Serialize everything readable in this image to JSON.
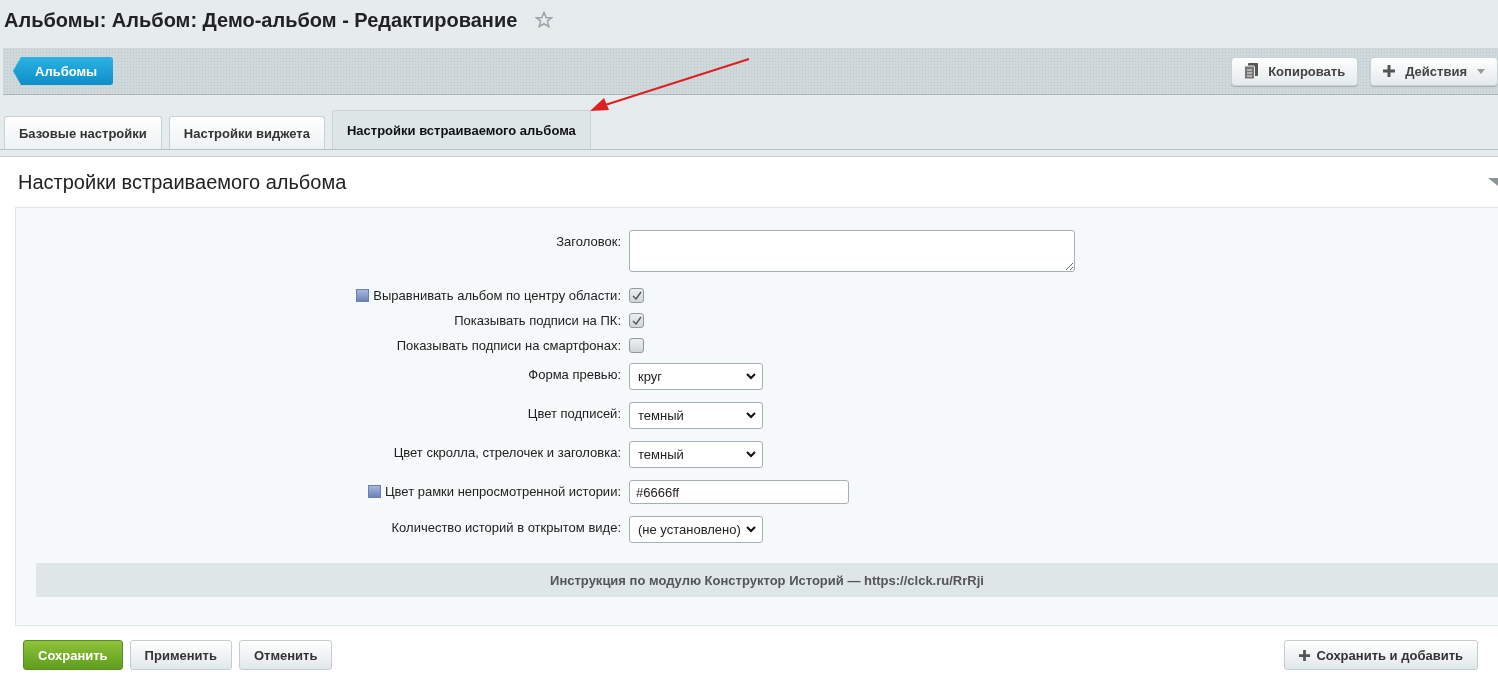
{
  "page_title": "Альбомы: Альбом: Демо-альбом - Редактирование",
  "favorite": false,
  "toolbar": {
    "back_button": "Альбомы",
    "buttons": [
      {
        "label": "Копировать",
        "kind": "copy"
      },
      {
        "label": "Действия",
        "kind": "menu"
      }
    ]
  },
  "tabs": [
    {
      "label": "Базовые настройки",
      "selected": false
    },
    {
      "label": "Настройки виджета",
      "selected": false
    },
    {
      "label": "Настройки встраиваемого альбома",
      "selected": true
    }
  ],
  "section": {
    "title": "Настройки встраиваемого альбома",
    "expanded": true
  },
  "fields": [
    {
      "kind": "textarea",
      "label": "Заголовок:",
      "help": false
    },
    {
      "kind": "checkbox",
      "label": "Выравнивать альбом по центру области:",
      "help": true,
      "checked": true
    },
    {
      "kind": "checkbox",
      "label": "Показывать подписи на ПК:",
      "help": false,
      "checked": true
    },
    {
      "kind": "checkbox",
      "label": "Показывать подписи на смартфонах:",
      "help": false,
      "checked": false
    },
    {
      "kind": "select",
      "label": "Форма превью:",
      "help": false,
      "value": "круг"
    },
    {
      "kind": "select",
      "label": "Цвет подписей:",
      "help": false,
      "value": "темный"
    },
    {
      "kind": "select",
      "label": "Цвет скролла, стрелочек и заголовка:",
      "help": false,
      "value": "темный"
    },
    {
      "kind": "text",
      "label": "Цвет рамки непросмотренной истории:",
      "help": true,
      "value": "#6666ff"
    },
    {
      "kind": "select",
      "label": "Количество историй в открытом виде:",
      "help": false,
      "value": "(не установлено)"
    }
  ],
  "note": "Инструкция по модулю Конструктор Историй — https://clck.ru/RrRji",
  "footer_buttons": [
    {
      "label": "Сохранить",
      "kind": "primary"
    },
    {
      "label": "Применить",
      "kind": "plain"
    },
    {
      "label": "Отменить",
      "kind": "plain"
    }
  ],
  "footer_right_button": "Сохранить и добавить"
}
